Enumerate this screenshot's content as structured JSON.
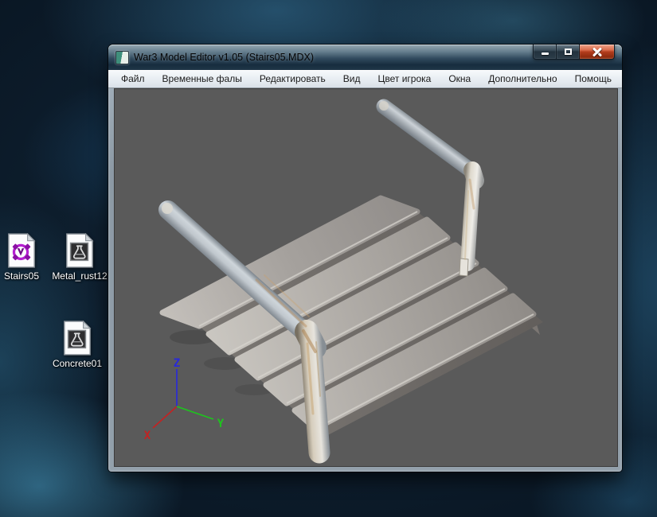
{
  "desktop": {
    "icons": [
      {
        "label": "Stairs05",
        "kind": "war3-model-file-icon"
      },
      {
        "label": "Metal_rust12",
        "kind": "texture-file-icon"
      },
      {
        "label": "Concrete01",
        "kind": "texture-file-icon"
      }
    ]
  },
  "window": {
    "title": "War3 Model Editor v1.05 (Stairs05.MDX)",
    "controls": {
      "minimize": "minimize-icon",
      "maximize": "maximize-icon",
      "close": "close-icon"
    },
    "menu": {
      "items": [
        "Файл",
        "Временные фалы",
        "Редактировать",
        "Вид",
        "Цвет игрока",
        "Окна",
        "Дополнительно",
        "Помощь"
      ]
    },
    "viewport": {
      "background_color": "#5a5a5a",
      "axis": {
        "x": {
          "label": "X",
          "color": "#c42222"
        },
        "y": {
          "label": "Y",
          "color": "#1ec41e"
        },
        "z": {
          "label": "Z",
          "color": "#2828dc"
        }
      }
    }
  },
  "colors": {
    "close_button": "#b13c1c",
    "menu_text": "#1a1a1a",
    "icon_label_text": "#ffffff"
  }
}
